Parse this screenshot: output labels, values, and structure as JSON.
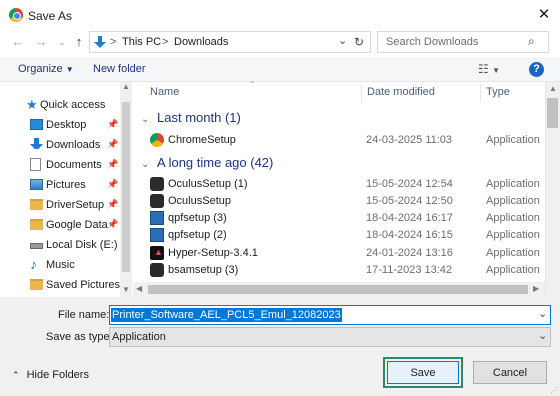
{
  "window": {
    "title": "Save As"
  },
  "nav": {
    "breadcrumb": [
      "This PC",
      "Downloads"
    ],
    "search_placeholder": "Search Downloads"
  },
  "toolbar": {
    "organize": "Organize",
    "new_folder": "New folder"
  },
  "sidebar": [
    {
      "label": "Quick access",
      "icon": "star-icon",
      "pinned": false
    },
    {
      "label": "Desktop",
      "icon": "desktop-icon",
      "pinned": true
    },
    {
      "label": "Downloads",
      "icon": "download-icon",
      "pinned": true
    },
    {
      "label": "Documents",
      "icon": "document-icon",
      "pinned": true
    },
    {
      "label": "Pictures",
      "icon": "pictures-icon",
      "pinned": true
    },
    {
      "label": "DriverSetup",
      "icon": "folder-icon",
      "pinned": true
    },
    {
      "label": "Google Data",
      "icon": "folder-icon",
      "pinned": true
    },
    {
      "label": "Local Disk (E:)",
      "icon": "drive-icon",
      "pinned": false
    },
    {
      "label": "Music",
      "icon": "music-icon",
      "pinned": false
    },
    {
      "label": "Saved Pictures",
      "icon": "folder-icon",
      "pinned": false
    }
  ],
  "columns": {
    "name": "Name",
    "date": "Date modified",
    "type": "Type"
  },
  "groups": [
    {
      "label": "Last month (1)",
      "files": [
        {
          "name": "ChromeSetup",
          "date": "24-03-2025 11:03",
          "type": "Application"
        }
      ]
    },
    {
      "label": "A long time ago (42)",
      "files": [
        {
          "name": "OculusSetup (1)",
          "date": "15-05-2024 12:54",
          "type": "Application"
        },
        {
          "name": "OculusSetup",
          "date": "15-05-2024 12:50",
          "type": "Application"
        },
        {
          "name": "qpfsetup (3)",
          "date": "18-04-2024 16:17",
          "type": "Application"
        },
        {
          "name": "qpfsetup (2)",
          "date": "18-04-2024 16:15",
          "type": "Application"
        },
        {
          "name": "Hyper-Setup-3.4.1",
          "date": "24-01-2024 13:16",
          "type": "Application"
        },
        {
          "name": "bsamsetup (3)",
          "date": "17-11-2023 13:42",
          "type": "Application"
        }
      ]
    }
  ],
  "form": {
    "file_name_label": "File name:",
    "file_name_value": "Printer_Software_AEL_PCL5_Emul_12082023",
    "save_type_label": "Save as type:",
    "save_type_value": "Application"
  },
  "footer": {
    "hide_folders": "Hide Folders",
    "save": "Save",
    "cancel": "Cancel"
  },
  "colors": {
    "accent": "#0078d7",
    "save_focus": "#2b8a6e",
    "group_text": "#1e3287"
  }
}
